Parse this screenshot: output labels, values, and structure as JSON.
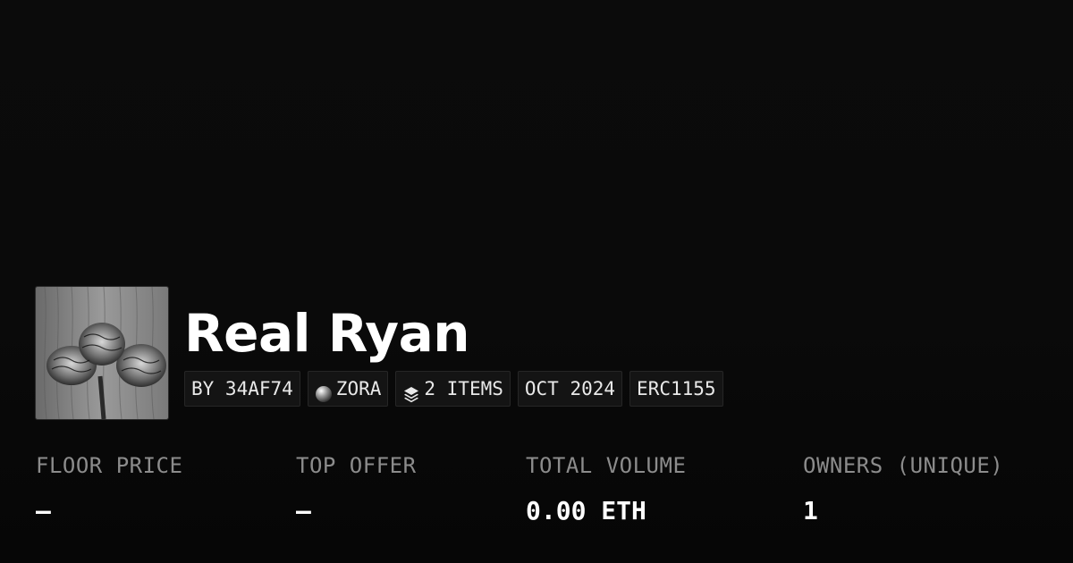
{
  "collection": {
    "title": "Real Ryan",
    "thumbnail_icon": "pinecone-photo",
    "chips": [
      {
        "label": "BY 34AF74",
        "icon": ""
      },
      {
        "label": "ZORA",
        "icon": "zora-orb-icon"
      },
      {
        "label": "2 ITEMS",
        "icon": "layers-icon"
      },
      {
        "label": "OCT 2024",
        "icon": ""
      },
      {
        "label": "ERC1155",
        "icon": ""
      }
    ]
  },
  "stats": [
    {
      "label": "FLOOR PRICE",
      "value": "—"
    },
    {
      "label": "TOP OFFER",
      "value": "—"
    },
    {
      "label": "TOTAL VOLUME",
      "value": "0.00 ETH"
    },
    {
      "label": "OWNERS (UNIQUE)",
      "value": "1"
    }
  ],
  "colors": {
    "background": "#0a0a0a",
    "chip_bg": "#141414",
    "label": "#8c8c8c",
    "value": "#ffffff"
  }
}
